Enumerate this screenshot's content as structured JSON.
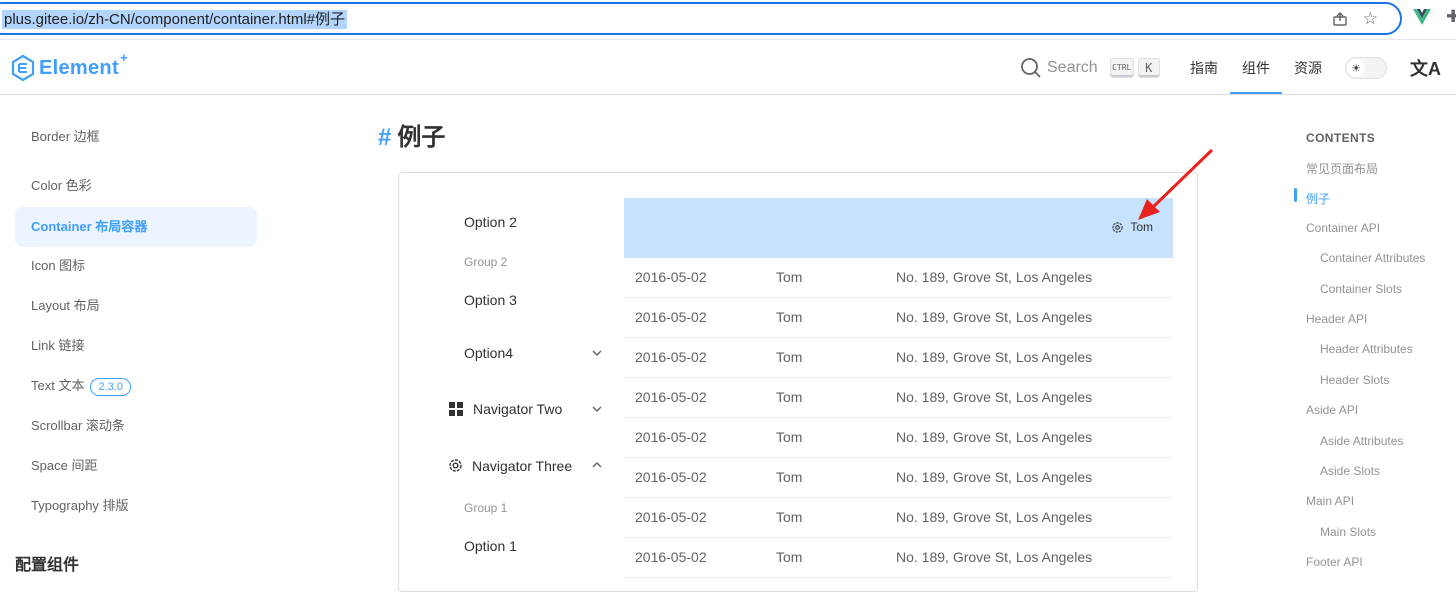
{
  "browser": {
    "url": "plus.gitee.io/zh-CN/component/container.html#例子"
  },
  "header": {
    "logo_text": "Element",
    "logo_plus": "+",
    "search_label": "Search",
    "kbd_ctrl": "CTRL",
    "kbd_k": "K",
    "nav": [
      "指南",
      "组件",
      "资源"
    ],
    "active_nav": "组件"
  },
  "sidebar": {
    "items": [
      {
        "label": "Border 边框"
      },
      {
        "label": "Color 色彩"
      },
      {
        "label": "Container 布局容器",
        "active": true
      },
      {
        "label": "Icon 图标"
      },
      {
        "label": "Layout 布局"
      },
      {
        "label": "Link 链接"
      },
      {
        "label": "Text 文本",
        "badge": "2.3.0"
      },
      {
        "label": "Scrollbar 滚动条"
      },
      {
        "label": "Space 间距"
      },
      {
        "label": "Typography 排版"
      }
    ],
    "group_title": "配置组件"
  },
  "main": {
    "hash": "#",
    "title": "例子"
  },
  "demo": {
    "menu": {
      "option2": "Option 2",
      "group2": "Group 2",
      "option3": "Option 3",
      "option4": "Option4",
      "navigator_two": "Navigator Two",
      "navigator_three": "Navigator Three",
      "group1": "Group 1",
      "option1": "Option 1"
    },
    "header_user": "Tom",
    "rows": [
      {
        "date": "2016-05-02",
        "name": "Tom",
        "address": "No. 189, Grove St, Los Angeles"
      },
      {
        "date": "2016-05-02",
        "name": "Tom",
        "address": "No. 189, Grove St, Los Angeles"
      },
      {
        "date": "2016-05-02",
        "name": "Tom",
        "address": "No. 189, Grove St, Los Angeles"
      },
      {
        "date": "2016-05-02",
        "name": "Tom",
        "address": "No. 189, Grove St, Los Angeles"
      },
      {
        "date": "2016-05-02",
        "name": "Tom",
        "address": "No. 189, Grove St, Los Angeles"
      },
      {
        "date": "2016-05-02",
        "name": "Tom",
        "address": "No. 189, Grove St, Los Angeles"
      },
      {
        "date": "2016-05-02",
        "name": "Tom",
        "address": "No. 189, Grove St, Los Angeles"
      },
      {
        "date": "2016-05-02",
        "name": "Tom",
        "address": "No. 189, Grove St, Los Angeles"
      }
    ]
  },
  "toc": {
    "title": "CONTENTS",
    "items": [
      {
        "label": "常见页面布局",
        "level": 1
      },
      {
        "label": "例子",
        "level": 1,
        "active": true
      },
      {
        "label": "Container API",
        "level": 1
      },
      {
        "label": "Container Attributes",
        "level": 2
      },
      {
        "label": "Container Slots",
        "level": 2
      },
      {
        "label": "Header API",
        "level": 1
      },
      {
        "label": "Header Attributes",
        "level": 2
      },
      {
        "label": "Header Slots",
        "level": 2
      },
      {
        "label": "Aside API",
        "level": 1
      },
      {
        "label": "Aside Attributes",
        "level": 2
      },
      {
        "label": "Aside Slots",
        "level": 2
      },
      {
        "label": "Main API",
        "level": 1
      },
      {
        "label": "Main Slots",
        "level": 2
      },
      {
        "label": "Footer API",
        "level": 1
      }
    ]
  },
  "colors": {
    "accent": "#409eff",
    "table_header_bg": "#c6e2ff",
    "annotation_arrow": "#e8231f"
  }
}
